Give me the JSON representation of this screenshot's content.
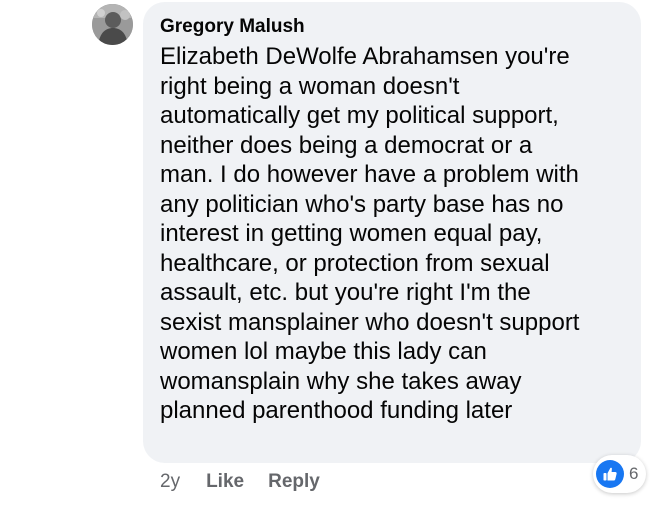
{
  "comment": {
    "author": "Gregory Malush",
    "text": "Elizabeth DeWolfe Abrahamsen you're\nright being a woman doesn't\nautomatically get my political support,\nneither does being a democrat or a\nman.  I do however have a problem with\nany politician who's party base has no\ninterest in getting women equal pay,\nhealthcare, or protection from sexual\nassault, etc. but you're right I'm the\nsexist mansplainer who doesn't support\nwomen lol maybe this lady can\nwomansplain why she takes away\nplanned parenthood funding later",
    "avatar_icon": "profile-photo"
  },
  "actions": {
    "time": "2y",
    "like_label": "Like",
    "reply_label": "Reply"
  },
  "reactions": {
    "icon": "thumbs-up-icon",
    "count": "6",
    "color": "#1877f2"
  },
  "colors": {
    "bubble": "#f0f2f5",
    "text": "#050505",
    "secondary": "#65676b"
  }
}
